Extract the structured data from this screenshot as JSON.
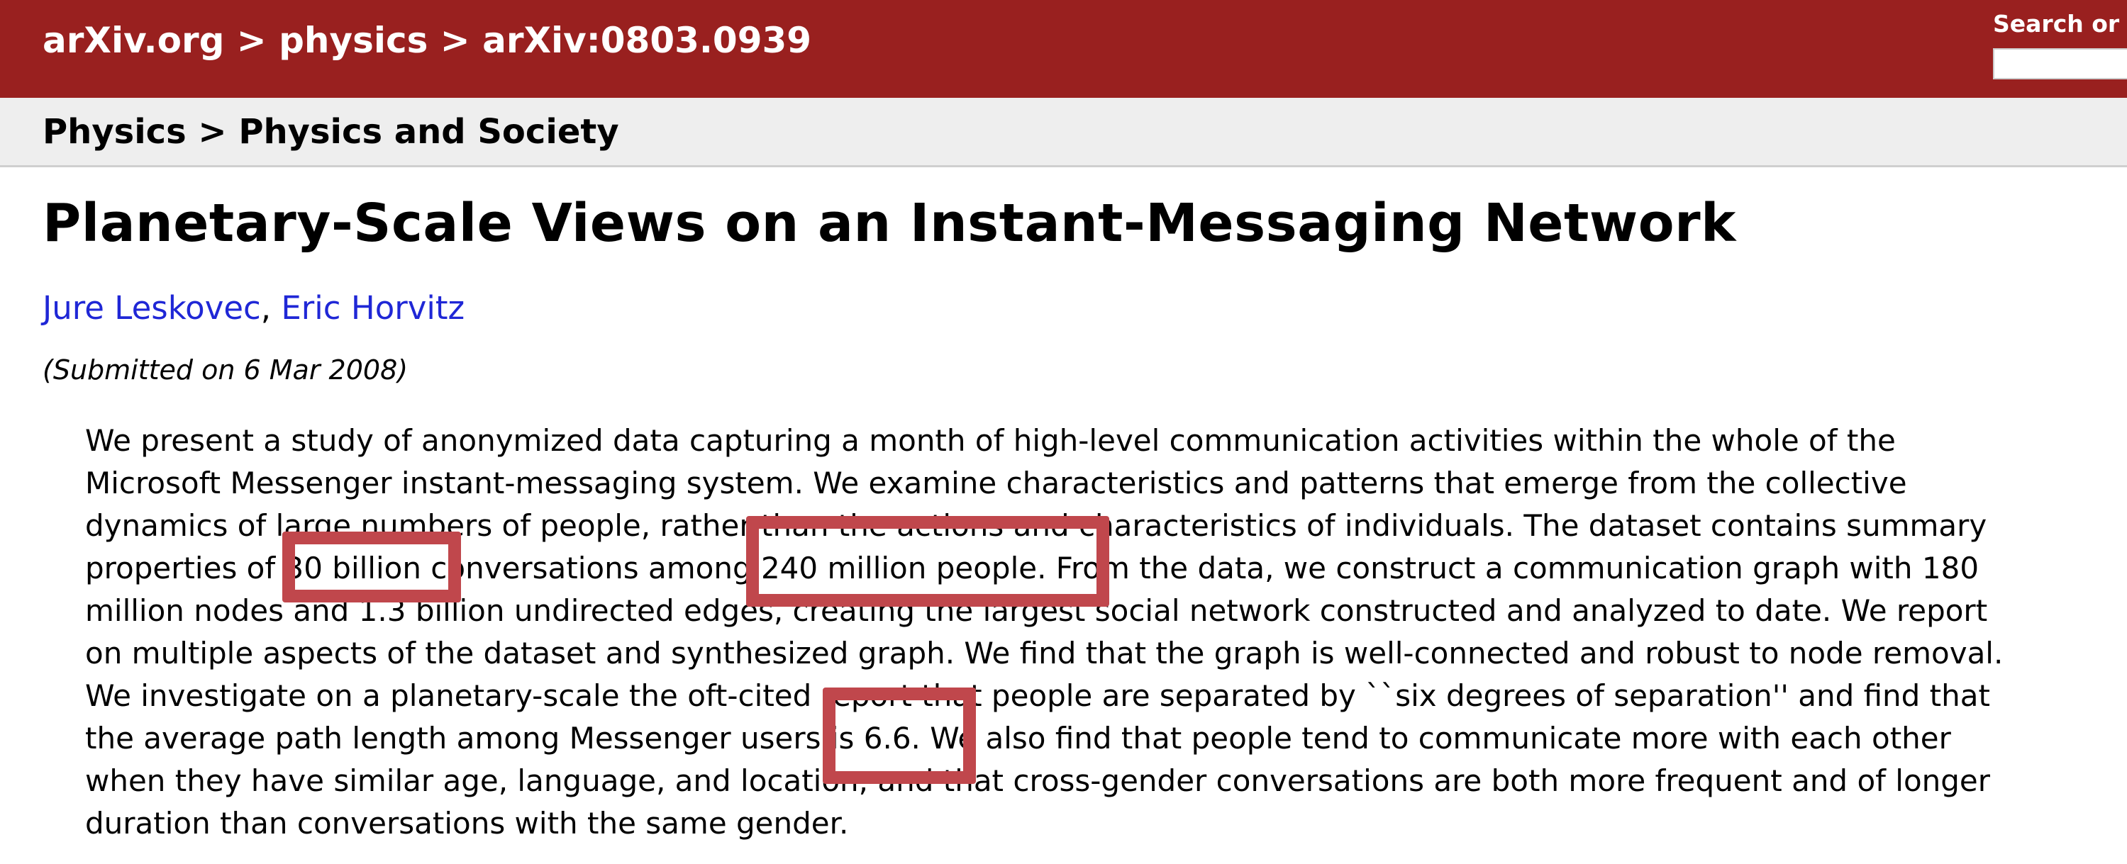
{
  "header": {
    "breadcrumb": "arXiv.org > physics > arXiv:0803.0939",
    "search_label": "Search or A"
  },
  "subheader": {
    "breadcrumb": "Physics > Physics and Society"
  },
  "paper": {
    "title": "Planetary-Scale Views on an Instant-Messaging Network",
    "authors": [
      "Jure Leskovec",
      "Eric Horvitz"
    ],
    "author_separator": ",",
    "submitted": "(Submitted on 6 Mar 2008)",
    "abstract_lines": [
      "We present a study of anonymized data capturing a month of high-level communication activities within the whole of the",
      "Microsoft Messenger instant-messaging system. We examine characteristics and patterns that emerge from the collective",
      "dynamics of large numbers of people, rather than the actions and characteristics of individuals. The dataset contains summary",
      "properties of 30 billion conversations among 240 million people. From the data, we construct a communication graph with 180",
      "million nodes and 1.3 billion undirected edges, creating the largest social network constructed and analyzed to date. We report",
      "on multiple aspects of the dataset and synthesized graph. We find that the graph is well-connected and robust to node removal.",
      "We investigate on a planetary-scale the oft-cited report that people are separated by ``six degrees of separation'' and find that",
      "the average path length among Messenger users is 6.6. We also find that people tend to communicate more with each other",
      "when they have similar age, language, and location, and that cross-gender conversations are both more frequent and of longer",
      "duration than conversations with the same gender."
    ],
    "highlights": [
      "30 billion",
      "240 million people.",
      "6.6."
    ]
  },
  "colors": {
    "header_bg": "#99201f",
    "subheader_bg": "#eeeeee",
    "author_link": "#1f27d6",
    "highlight_box": "#c0474c"
  }
}
